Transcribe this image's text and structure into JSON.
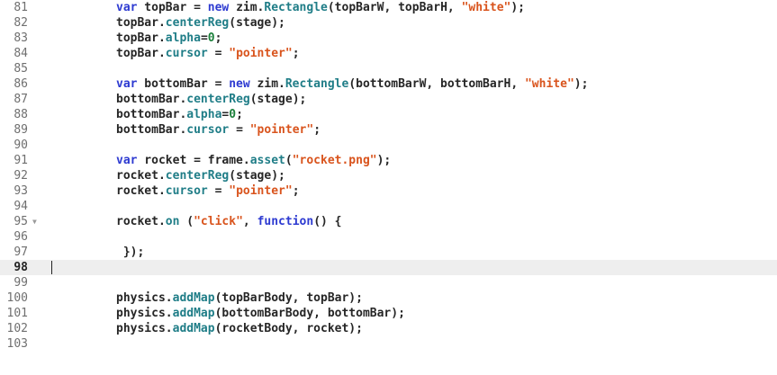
{
  "editor": {
    "language": "javascript",
    "current_line": "98",
    "colors": {
      "keyword": "#2d3ad1",
      "function": "#1f7d87",
      "string": "#d9541d",
      "number": "#1b7f3a",
      "text": "#262626",
      "current_line_bg": "#eeeeee"
    },
    "lines": [
      {
        "n": "81",
        "tokens": [
          [
            "kw",
            "var"
          ],
          [
            "txt",
            " topBar = "
          ],
          [
            "kw",
            "new"
          ],
          [
            "txt",
            " zim."
          ],
          [
            "fn",
            "Rectangle"
          ],
          [
            "txt",
            "(topBarW, topBarH, "
          ],
          [
            "str",
            "\"white\""
          ],
          [
            "txt",
            ");"
          ]
        ]
      },
      {
        "n": "82",
        "tokens": [
          [
            "txt",
            "topBar."
          ],
          [
            "fn",
            "centerReg"
          ],
          [
            "txt",
            "(stage);"
          ]
        ]
      },
      {
        "n": "83",
        "tokens": [
          [
            "txt",
            "topBar."
          ],
          [
            "fn",
            "alpha"
          ],
          [
            "txt",
            "="
          ],
          [
            "num",
            "0"
          ],
          [
            "txt",
            ";"
          ]
        ]
      },
      {
        "n": "84",
        "tokens": [
          [
            "txt",
            "topBar."
          ],
          [
            "fn",
            "cursor"
          ],
          [
            "txt",
            " = "
          ],
          [
            "str",
            "\"pointer\""
          ],
          [
            "txt",
            ";"
          ]
        ]
      },
      {
        "n": "85",
        "tokens": []
      },
      {
        "n": "86",
        "tokens": [
          [
            "kw",
            "var"
          ],
          [
            "txt",
            " bottomBar = "
          ],
          [
            "kw",
            "new"
          ],
          [
            "txt",
            " zim."
          ],
          [
            "fn",
            "Rectangle"
          ],
          [
            "txt",
            "(bottomBarW, bottomBarH, "
          ],
          [
            "str",
            "\"white\""
          ],
          [
            "txt",
            ");"
          ]
        ]
      },
      {
        "n": "87",
        "tokens": [
          [
            "txt",
            "bottomBar."
          ],
          [
            "fn",
            "centerReg"
          ],
          [
            "txt",
            "(stage);"
          ]
        ]
      },
      {
        "n": "88",
        "tokens": [
          [
            "txt",
            "bottomBar."
          ],
          [
            "fn",
            "alpha"
          ],
          [
            "txt",
            "="
          ],
          [
            "num",
            "0"
          ],
          [
            "txt",
            ";"
          ]
        ]
      },
      {
        "n": "89",
        "tokens": [
          [
            "txt",
            "bottomBar."
          ],
          [
            "fn",
            "cursor"
          ],
          [
            "txt",
            " = "
          ],
          [
            "str",
            "\"pointer\""
          ],
          [
            "txt",
            ";"
          ]
        ]
      },
      {
        "n": "90",
        "tokens": []
      },
      {
        "n": "91",
        "tokens": [
          [
            "kw",
            "var"
          ],
          [
            "txt",
            " rocket = frame."
          ],
          [
            "fn",
            "asset"
          ],
          [
            "txt",
            "("
          ],
          [
            "str",
            "\"rocket.png\""
          ],
          [
            "txt",
            ");"
          ]
        ]
      },
      {
        "n": "92",
        "tokens": [
          [
            "txt",
            "rocket."
          ],
          [
            "fn",
            "centerReg"
          ],
          [
            "txt",
            "(stage);"
          ]
        ]
      },
      {
        "n": "93",
        "tokens": [
          [
            "txt",
            "rocket."
          ],
          [
            "fn",
            "cursor"
          ],
          [
            "txt",
            " = "
          ],
          [
            "str",
            "\"pointer\""
          ],
          [
            "txt",
            ";"
          ]
        ]
      },
      {
        "n": "94",
        "tokens": []
      },
      {
        "n": "95",
        "fold": "▼",
        "tokens": [
          [
            "txt",
            "rocket."
          ],
          [
            "fn",
            "on"
          ],
          [
            "txt",
            " ("
          ],
          [
            "str",
            "\"click\""
          ],
          [
            "txt",
            ", "
          ],
          [
            "kw",
            "function"
          ],
          [
            "txt",
            "() {"
          ]
        ]
      },
      {
        "n": "96",
        "tokens": []
      },
      {
        "n": "97",
        "tokens": [
          [
            "txt",
            " });"
          ]
        ]
      },
      {
        "n": "98",
        "current": true,
        "tokens": []
      },
      {
        "n": "99",
        "tokens": []
      },
      {
        "n": "100",
        "tokens": [
          [
            "txt",
            "physics."
          ],
          [
            "fn",
            "addMap"
          ],
          [
            "txt",
            "(topBarBody, topBar);"
          ]
        ]
      },
      {
        "n": "101",
        "tokens": [
          [
            "txt",
            "physics."
          ],
          [
            "fn",
            "addMap"
          ],
          [
            "txt",
            "(bottomBarBody, bottomBar);"
          ]
        ]
      },
      {
        "n": "102",
        "tokens": [
          [
            "txt",
            "physics."
          ],
          [
            "fn",
            "addMap"
          ],
          [
            "txt",
            "(rocketBody, rocket);"
          ]
        ]
      },
      {
        "n": "103",
        "tokens": []
      }
    ]
  }
}
